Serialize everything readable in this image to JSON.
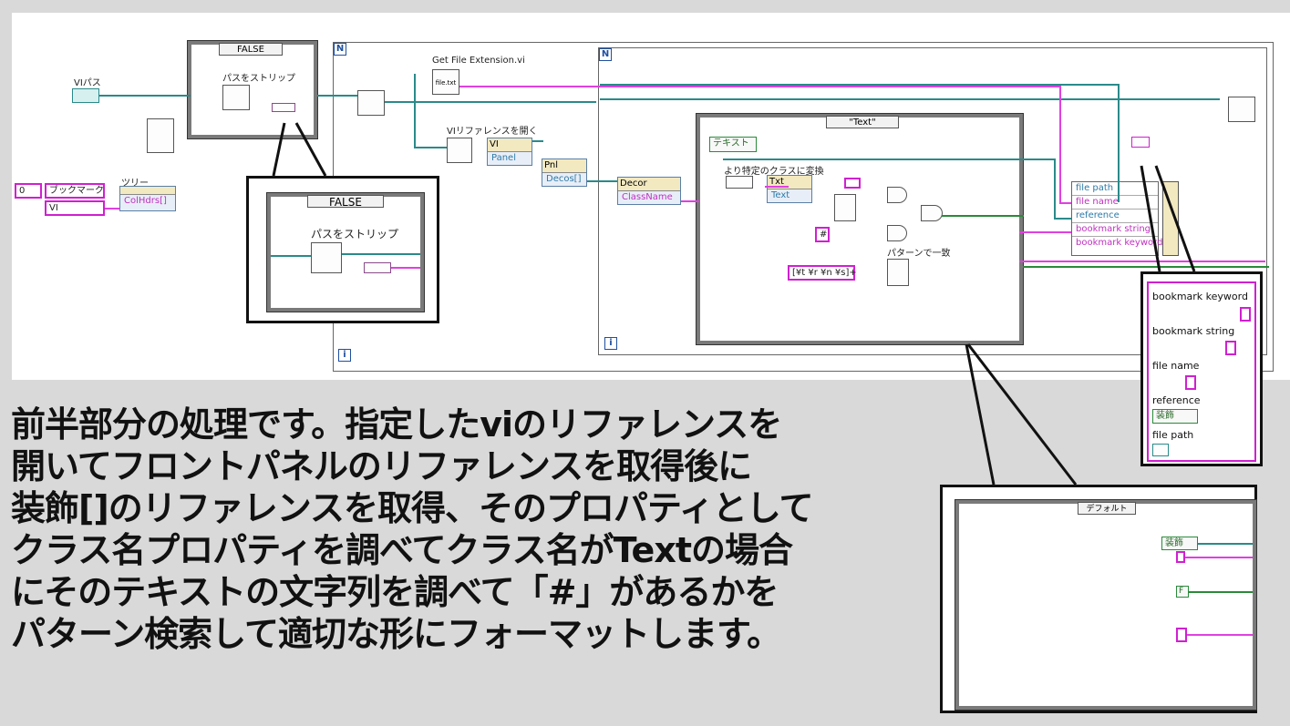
{
  "diagram": {
    "vi_path_label": "VIパス",
    "tree_label": "ツリー",
    "bookmark_array": [
      "0",
      "ブックマーク",
      "VI"
    ],
    "colhdrs": "ColHdrs[]",
    "case_false": "FALSE",
    "strip_path": "パスをストリップ",
    "get_file_ext": "Get File Extension.vi",
    "file_txt": "file.txt",
    "open_vi_ref": "VIリファレンスを開く",
    "vi_node": "VI",
    "panel": "Panel",
    "pnl": "Pnl",
    "decos": "Decos[]",
    "decor": "Decor",
    "classname": "ClassName",
    "case_text": "\"Text\"",
    "text_const": "テキスト",
    "to_more_specific": "より特定のクラスに変換",
    "txt": "Txt",
    "text": "Text",
    "hash_const": "#",
    "regex_const": "[¥t ¥r ¥n ¥s]+",
    "match_pattern": "パターンで一致",
    "bundle_fields": [
      "file path",
      "file name",
      "reference",
      "bookmark string",
      "bookmark keyword"
    ],
    "loop_i": "i",
    "loop_n": "N"
  },
  "callouts": {
    "false_case": "FALSE",
    "strip_path": "パスをストリップ",
    "cluster_fields": [
      "bookmark keyword",
      "bookmark string",
      "file name",
      "reference",
      "file path"
    ],
    "reference_const": "装飾",
    "default_case": "デフォルト",
    "default_ref": "装飾",
    "default_bool": "F"
  },
  "explanation": [
    "前半部分の処理です。指定したviのリファレンスを",
    "開いてフロントパネルのリファレンスを取得後に",
    "装飾[]のリファレンスを取得、そのプロパティとして",
    "クラス名プロパティを調べてクラス名がTextの場合",
    "にそのテキストの文字列を調べて「#」があるかを",
    "パターン検索して適切な形にフォーマットします。"
  ],
  "colors": {
    "wire_teal": "#2a8a8a",
    "wire_pink": "#e040e0",
    "wire_green": "#2a8a3a",
    "frame": "#7a7a7a"
  }
}
